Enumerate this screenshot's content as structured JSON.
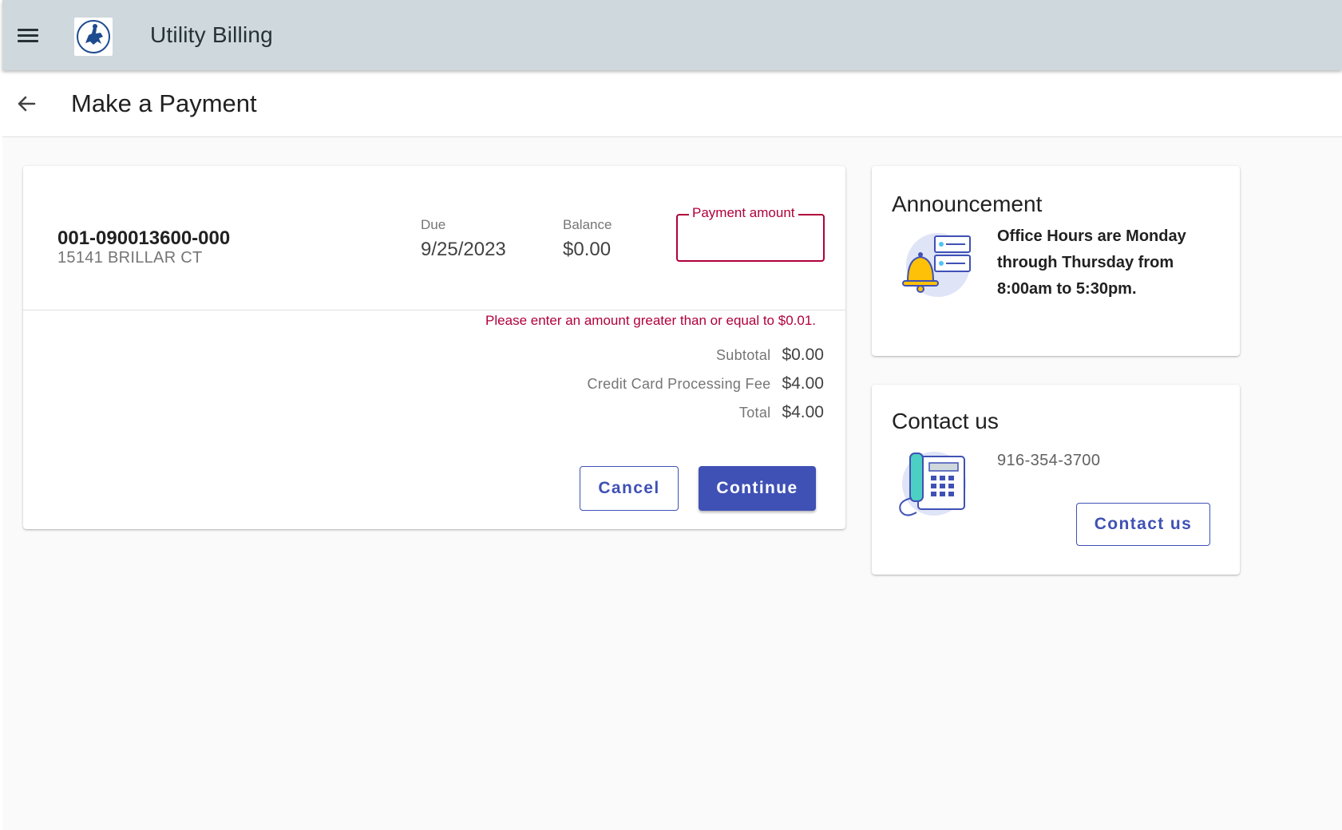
{
  "appbar": {
    "title": "Utility Billing"
  },
  "page": {
    "title": "Make a Payment"
  },
  "payment": {
    "account_number": "001-090013600-000",
    "address": "15141 BRILLAR CT",
    "due_label": "Due",
    "due_value": "9/25/2023",
    "balance_label": "Balance",
    "balance_value": "$0.00",
    "amount_label": "Payment amount",
    "amount_value": "",
    "error": "Please enter an amount greater than or equal to $0.01.",
    "subtotal_label": "Subtotal",
    "subtotal_value": "$0.00",
    "fee_label": "Credit Card Processing Fee",
    "fee_value": "$4.00",
    "total_label": "Total",
    "total_value": "$4.00",
    "cancel_label": "Cancel",
    "continue_label": "Continue"
  },
  "announcement": {
    "title": "Announcement",
    "text": "Office Hours are Monday through Thursday from 8:00am to 5:30pm.",
    "icon": "bell-list-icon"
  },
  "contact": {
    "title": "Contact us",
    "phone": "916-354-3700",
    "button_label": "Contact us",
    "icon": "desk-phone-icon"
  },
  "colors": {
    "appbar_bg": "#cfd8dc",
    "primary": "#3f51b5",
    "error": "#b0003a",
    "page_bg": "#fafafa"
  }
}
